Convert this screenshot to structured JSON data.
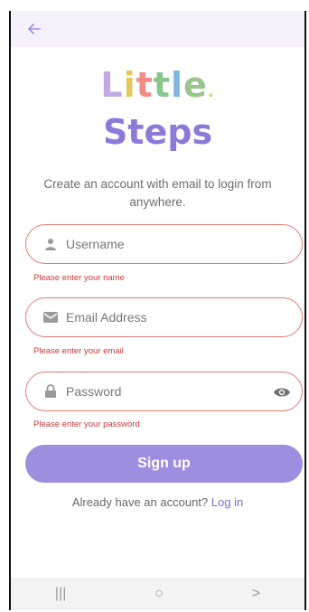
{
  "header": {
    "back_icon": "arrow-left-icon"
  },
  "logo": {
    "line1_letters": [
      "L",
      "i",
      "t",
      "t",
      "l",
      "e"
    ],
    "line1_colors": [
      "#c6a6e6",
      "#e6c95a",
      "#f08b86",
      "#8bc58e",
      "#7fb6e0",
      "#9ac58e"
    ],
    "dot": ".",
    "line2": "Steps"
  },
  "subtitle": "Create an account with email to login from anywhere.",
  "form": {
    "username": {
      "placeholder": "Username",
      "icon": "person-icon",
      "error": "Please enter your name"
    },
    "email": {
      "placeholder": "Email Address",
      "icon": "mail-icon",
      "error": "Please enter your email"
    },
    "password": {
      "placeholder": "Password",
      "icon": "lock-icon",
      "error": "Please enter your password",
      "toggle_icon": "eye-icon"
    },
    "submit_label": "Sign up"
  },
  "login": {
    "prompt": "Already have an account?",
    "link": "Log in"
  },
  "navbar": {
    "recents": "|||",
    "home": "○",
    "back": ">"
  }
}
